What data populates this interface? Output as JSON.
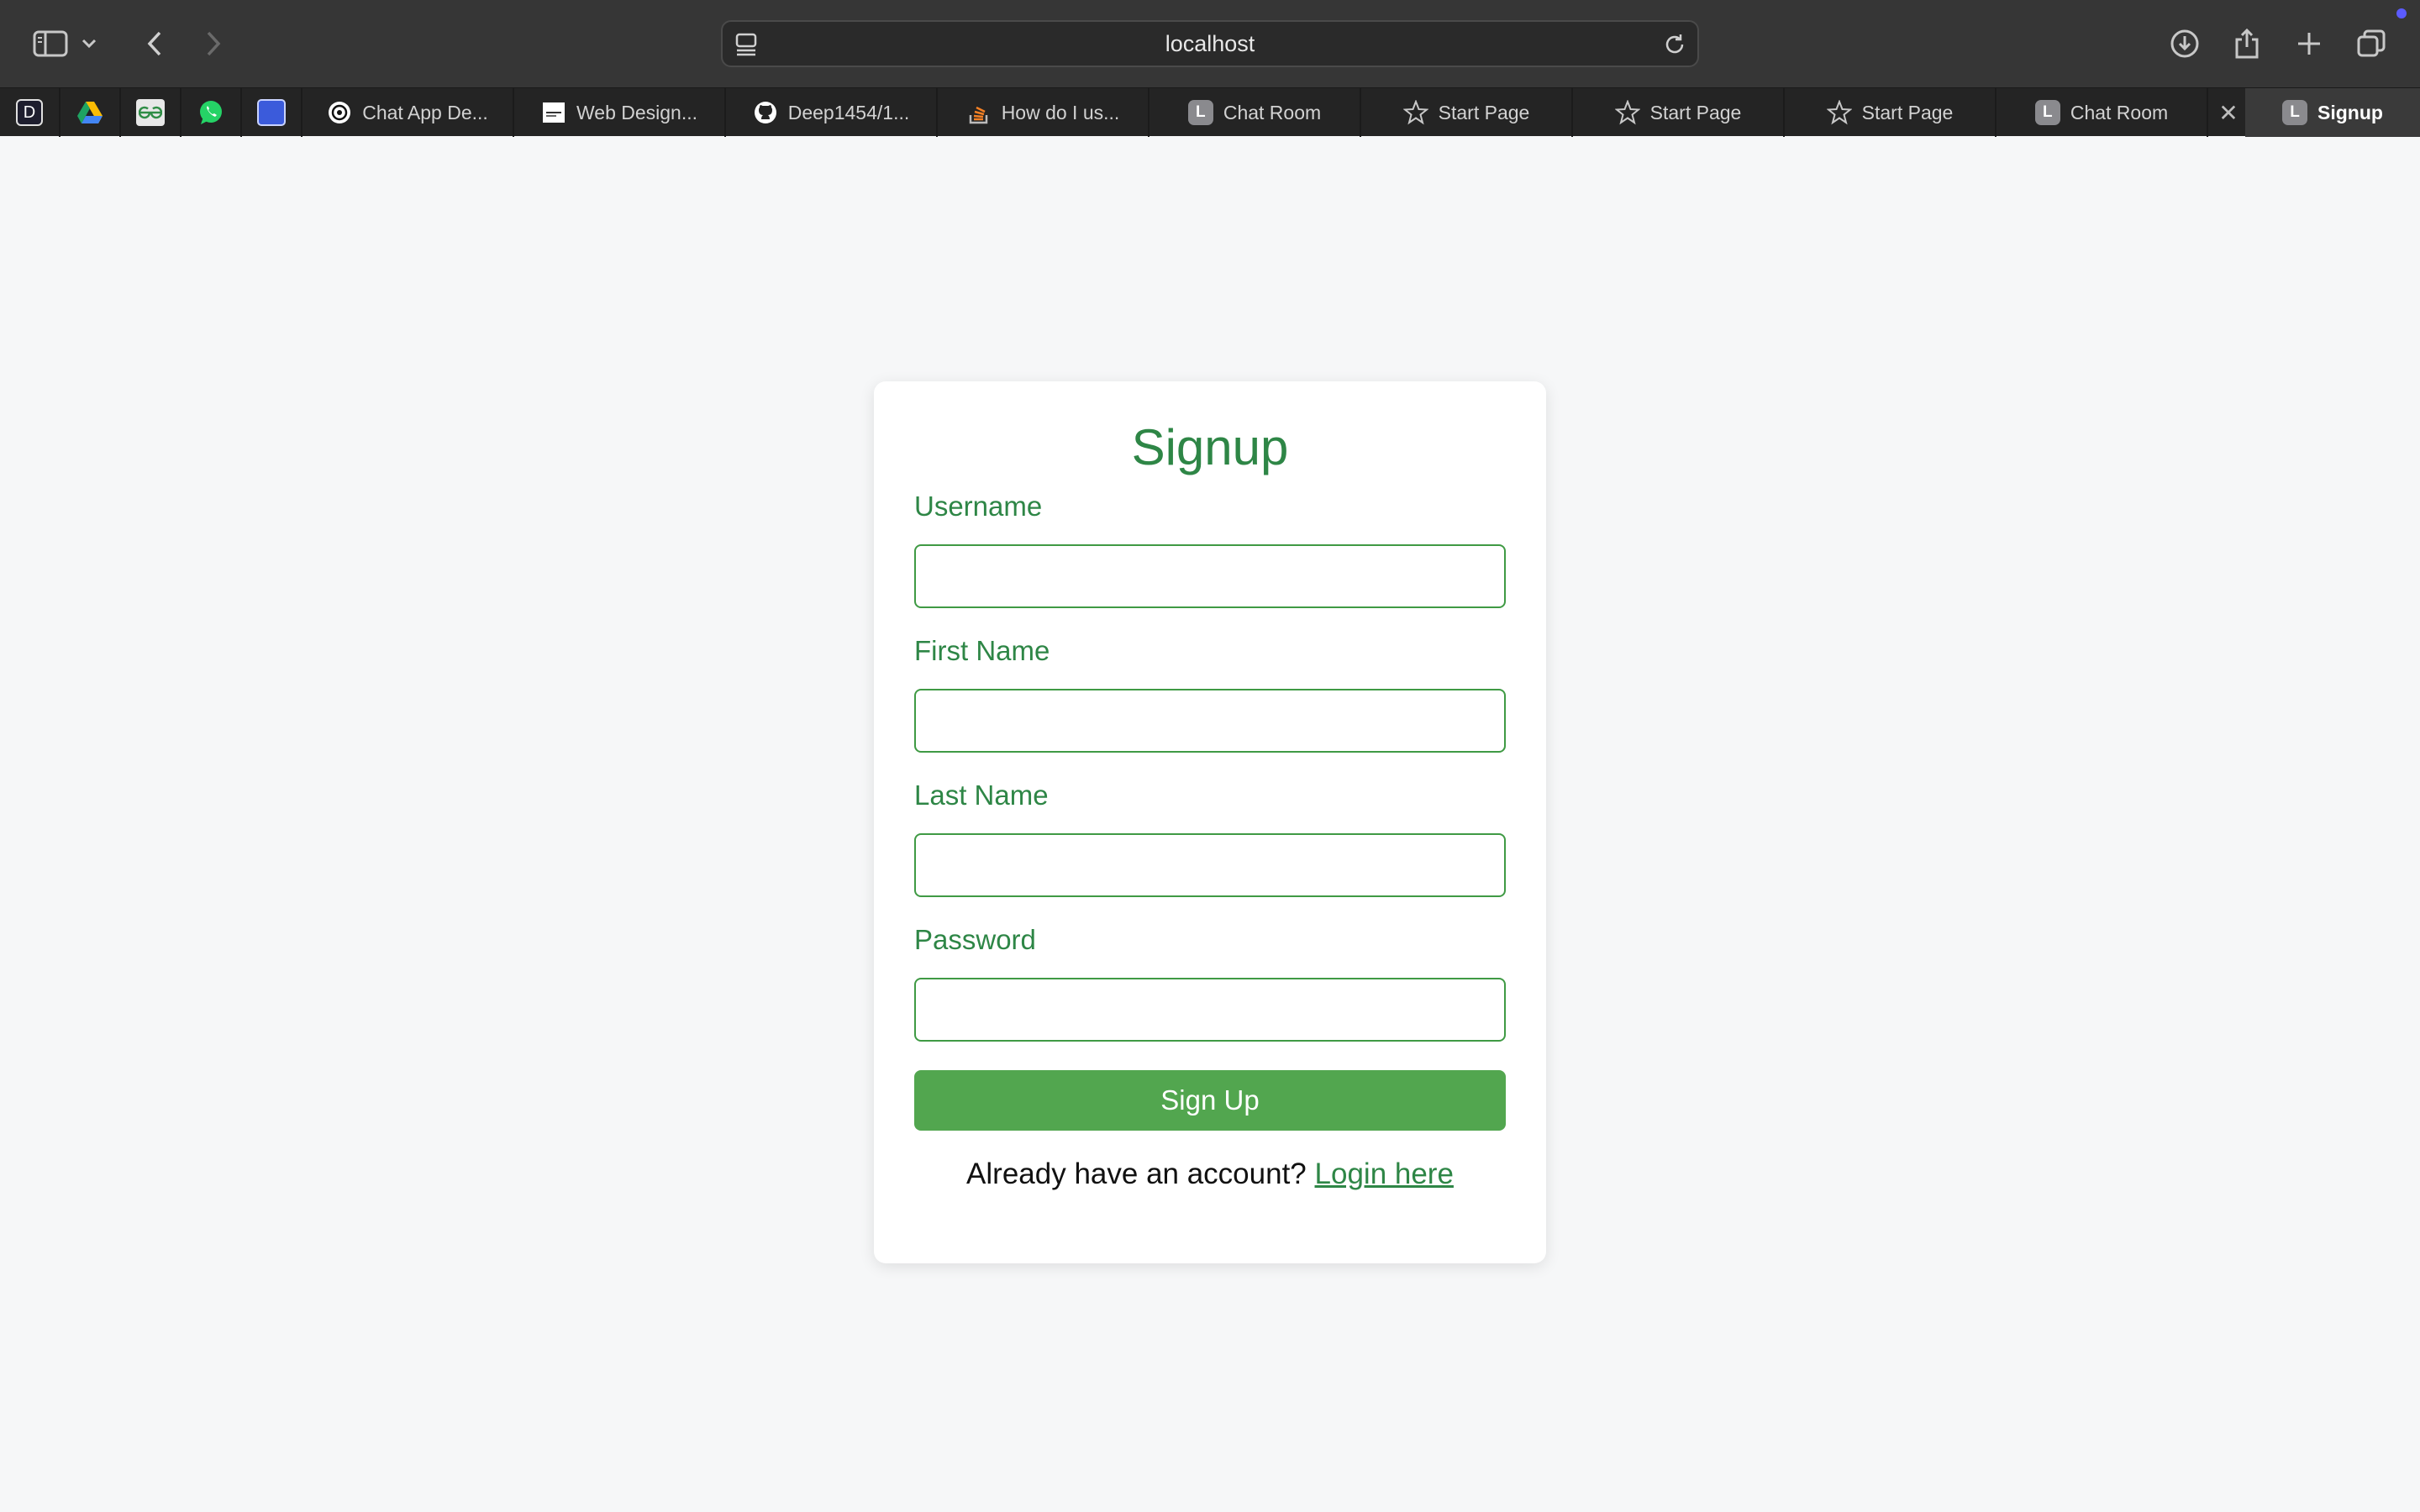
{
  "browser": {
    "url": "localhost",
    "pinned_tabs": [
      {
        "icon": "d-letter-icon",
        "letter": "D"
      },
      {
        "icon": "google-drive-icon"
      },
      {
        "icon": "geeksforgeeks-icon"
      },
      {
        "icon": "whatsapp-icon"
      },
      {
        "icon": "blue-app-icon"
      }
    ],
    "tabs": [
      {
        "label": "Chat App De...",
        "icon": "openai-icon"
      },
      {
        "label": "Web Design...",
        "icon": "document-thumbnail-icon"
      },
      {
        "label": "Deep1454/1...",
        "icon": "github-icon"
      },
      {
        "label": "How do I us...",
        "icon": "stackoverflow-icon"
      },
      {
        "label": "Chat Room",
        "icon": "l-letter-icon",
        "letter": "L"
      },
      {
        "label": "Start Page",
        "icon": "star-icon"
      },
      {
        "label": "Start Page",
        "icon": "star-icon"
      },
      {
        "label": "Start Page",
        "icon": "star-icon"
      },
      {
        "label": "Chat Room",
        "icon": "l-letter-icon",
        "letter": "L"
      },
      {
        "label": "Signup",
        "icon": "l-letter-icon",
        "letter": "L",
        "active": true
      }
    ]
  },
  "form": {
    "title": "Signup",
    "fields": [
      {
        "label": "Username",
        "value": "",
        "type": "text"
      },
      {
        "label": "First Name",
        "value": "",
        "type": "text"
      },
      {
        "label": "Last Name",
        "value": "",
        "type": "text"
      },
      {
        "label": "Password",
        "value": "",
        "type": "password"
      }
    ],
    "submit_label": "Sign Up",
    "footer_text": "Already have an account?",
    "login_link": "Login here"
  },
  "colors": {
    "accent": "#2e8646",
    "button": "#52a64f",
    "page_bg": "#f6f7f8",
    "chrome_bg": "#363636"
  }
}
